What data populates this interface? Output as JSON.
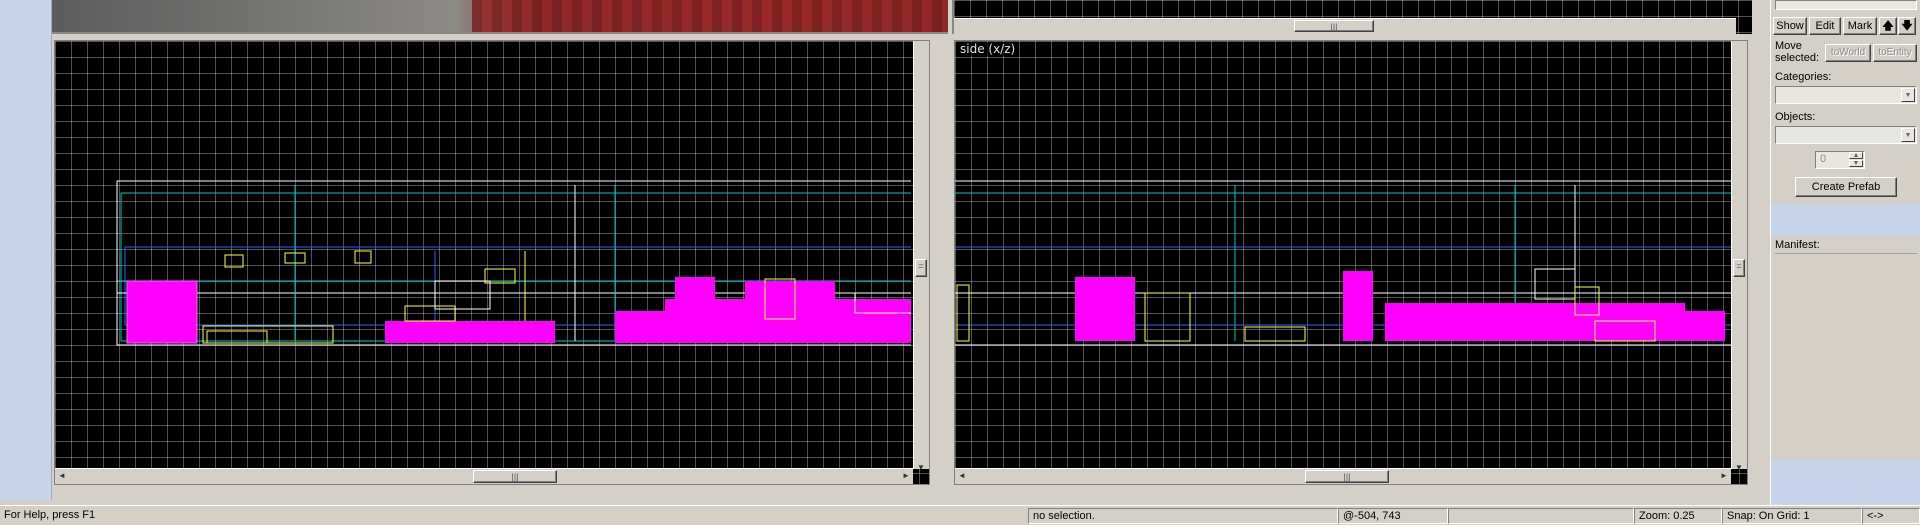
{
  "panel": {
    "show_label": "Show",
    "edit_label": "Edit",
    "mark_label": "Mark",
    "move_up_icon": "arrow-up-icon",
    "move_down_icon": "arrow-down-icon",
    "move_selected_label": "Move selected:",
    "to_world_label": "toWorld",
    "to_entity_label": "toEntity",
    "categories_label": "Categories:",
    "objects_label": "Objects:",
    "count_value": "0",
    "create_prefab_label": "Create Prefab",
    "manifest_label": "Manifest:"
  },
  "viewports": {
    "side_label": "side (x/z)"
  },
  "status": {
    "help": "For Help, press F1",
    "selection": "no selection.",
    "coords": "@-504, 743",
    "zoom": "Zoom: 0.25",
    "snap": "Snap: On Grid: 1",
    "extra": "<->"
  },
  "colors": {
    "texture_missing": "#ff00ff",
    "brush_cyan": "#00c8c8",
    "brush_yellow": "#ffff40",
    "brush_blue": "#3060ff",
    "brush_white": "#ffffff"
  }
}
